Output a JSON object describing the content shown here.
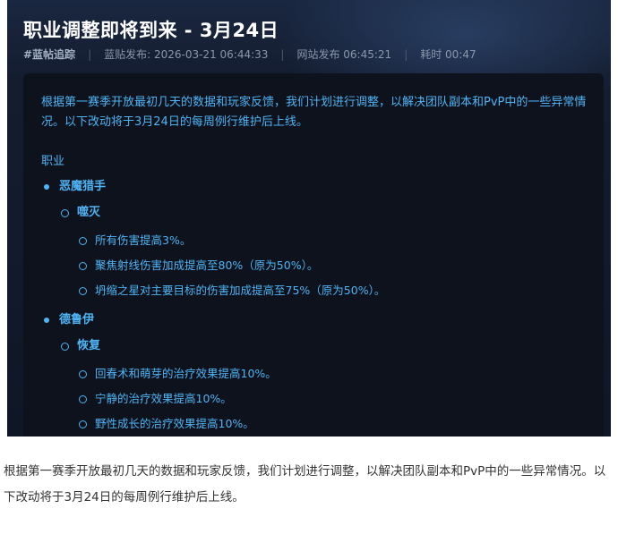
{
  "screenshot": {
    "title": "职业调整即将到来 - 3月24日",
    "meta": {
      "tag": "#蓝帖追踪",
      "blue_post": "蓝贴发布: 2026-03-21 06:44:33",
      "site_post": "网站发布 06:45:21",
      "elapsed": "耗时 00:47"
    },
    "intro": "根据第一赛季开放最初几天的数据和玩家反馈，我们计划进行调整，以解决团队副本和PvP中的一些异常情况。以下改动将于3月24日的每周例行维护后上线。",
    "section_label": "职业",
    "classes": [
      {
        "name": "恶魔猎手",
        "specs": [
          {
            "name": "噬灭",
            "changes": [
              "所有伤害提高3%。",
              "聚焦射线伤害加成提高至80%（原为50%）。",
              "坍缩之星对主要目标的伤害加成提高至75%（原为50%）。"
            ]
          }
        ]
      },
      {
        "name": "德鲁伊",
        "specs": [
          {
            "name": "恢复",
            "changes": [
              "回春术和萌芽的治疗效果提高10%。",
              "宁静的治疗效果提高10%。",
              "野性成长的治疗效果提高10%。"
            ]
          }
        ]
      }
    ]
  },
  "article_text": "根据第一赛季开放最初几天的数据和玩家反馈，我们计划进行调整，以解决团队副本和PvP中的一些异常情况。以下改动将于3月24日的每周例行维护后上线。",
  "colors": {
    "accent_blue": "#4fb4f5",
    "panel_bg": "#0d121c",
    "header_bg": "#1a2740"
  }
}
